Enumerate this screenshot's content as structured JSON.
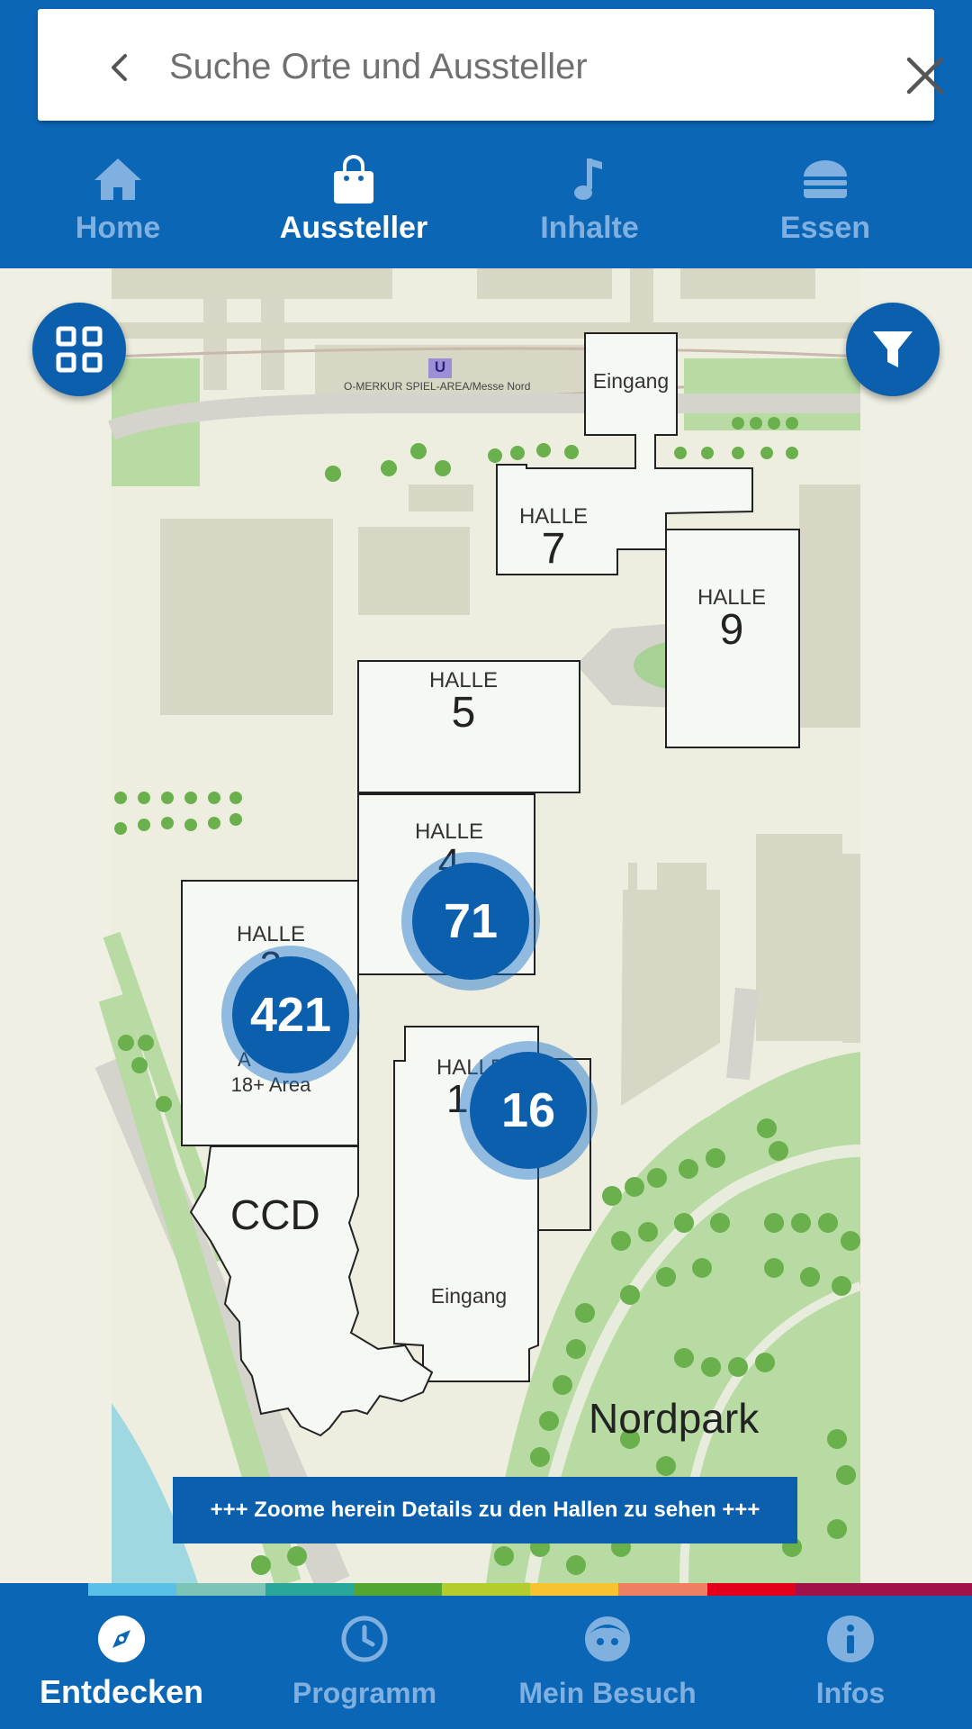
{
  "search": {
    "placeholder": "Suche Orte und Aussteller"
  },
  "top_tabs": [
    {
      "label": "Home",
      "icon": "home-icon",
      "active": false
    },
    {
      "label": "Aussteller",
      "icon": "shopping-bag-icon",
      "active": true
    },
    {
      "label": "Inhalte",
      "icon": "music-note-icon",
      "active": false
    },
    {
      "label": "Essen",
      "icon": "burger-icon",
      "active": false
    }
  ],
  "map": {
    "station_label": "O-MERKUR SPIEL-AREA/Messe Nord",
    "station_badge": "U",
    "entrance_top": "Eingang",
    "entrance_bottom": "Eingang",
    "halls": [
      {
        "label": "HALLE",
        "number": "7"
      },
      {
        "label": "HALLE",
        "number": "9"
      },
      {
        "label": "HALLE",
        "number": "5"
      },
      {
        "label": "HALLE",
        "number": "4"
      },
      {
        "label": "HALLE",
        "number": "3"
      },
      {
        "label": "HALLE",
        "number": "1"
      }
    ],
    "hall3_sub_a": "A",
    "hall3_sub_b": "18+ Area",
    "ccd_label": "CCD",
    "park_label": "Nordpark",
    "clusters": [
      {
        "count": "71"
      },
      {
        "count": "421"
      },
      {
        "count": "16"
      }
    ],
    "zoom_hint": "+++ Zoome herein Details zu den Hallen zu sehen +++"
  },
  "color_stripe": [
    "#0b66b6",
    "#5bc0e8",
    "#7dc4b8",
    "#2aa79b",
    "#55a630",
    "#b5cc2e",
    "#f7c331",
    "#ee7f61",
    "#e2001a",
    "#a1124a",
    "#a1124a"
  ],
  "bottom_nav": [
    {
      "label": "Entdecken",
      "icon": "compass-icon",
      "active": true
    },
    {
      "label": "Programm",
      "icon": "clock-icon",
      "active": false
    },
    {
      "label": "Mein Besuch",
      "icon": "face-icon",
      "active": false
    },
    {
      "label": "Infos",
      "icon": "info-icon",
      "active": false
    }
  ]
}
